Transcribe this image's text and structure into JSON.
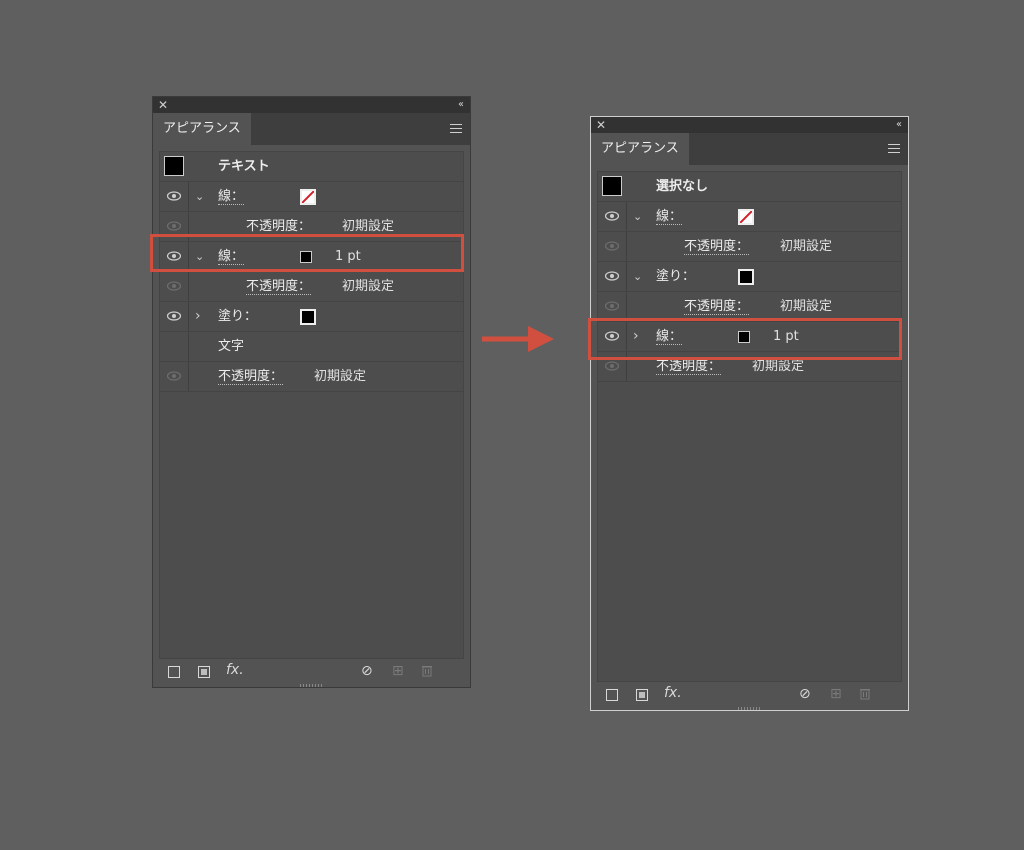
{
  "left_panel": {
    "tab": "アピアランス",
    "header": "テキスト",
    "rows": [
      {
        "label": "線：",
        "opacity_label": "不透明度：",
        "opacity_value": "初期設定"
      },
      {
        "label": "線：",
        "weight": "1 pt",
        "opacity_label": "不透明度：",
        "opacity_value": "初期設定"
      },
      {
        "label": "塗り："
      },
      {
        "label": "文字"
      },
      {
        "label": "不透明度：",
        "value": "初期設定"
      }
    ]
  },
  "right_panel": {
    "tab": "アピアランス",
    "header": "選択なし",
    "rows": [
      {
        "label": "線：",
        "opacity_label": "不透明度：",
        "opacity_value": "初期設定"
      },
      {
        "label": "塗り：",
        "opacity_label": "不透明度：",
        "opacity_value": "初期設定"
      },
      {
        "label": "線：",
        "weight": "1 pt"
      },
      {
        "label": "不透明度：",
        "value": "初期設定"
      }
    ]
  },
  "icons": {
    "close": "✕",
    "collapse": "‹‹",
    "chevron_down": "⌄",
    "chevron_right": "›",
    "fx": "fx.",
    "clear": "⊘",
    "add": "⊞",
    "trash": "🗑"
  },
  "colors": {
    "highlight": "#d14f3f",
    "none_slash": "#d0202a"
  }
}
